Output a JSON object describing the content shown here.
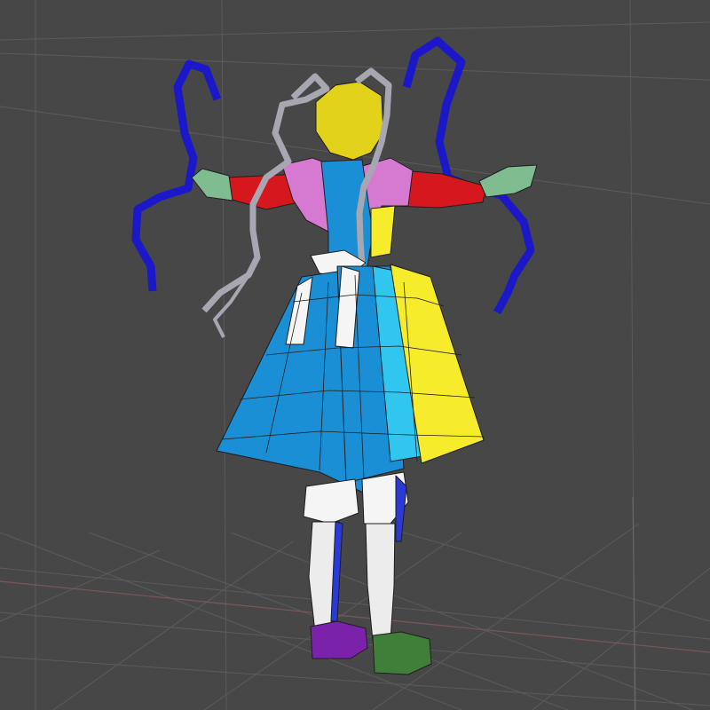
{
  "viewport": {
    "background": "#474747",
    "grid_color": "#5a5a5a",
    "axis_x_color": "#7a5a5a",
    "axis_y_color": "#5a8a5a"
  },
  "model": {
    "colors": {
      "wireframe": "#1e1e1e",
      "hair_yellow": "#e2d21a",
      "hair_tentacle": "#1b18c9",
      "hair_ribbon_gray": "#a7a7b2",
      "sleeve_red": "#d5181d",
      "shoulder_pink": "#d679d1",
      "hand_green": "#7fbd90",
      "dress_blue": "#1b8fd6",
      "dress_cyan": "#30c6ef",
      "dress_yellow": "#f6ec2c",
      "apron_white": "#f5f5f5",
      "leg_white": "#ececec",
      "shoe_purple": "#7a22a9",
      "shoe_green": "#3f7f3a",
      "sock_blue": "#2a3ad6"
    }
  }
}
